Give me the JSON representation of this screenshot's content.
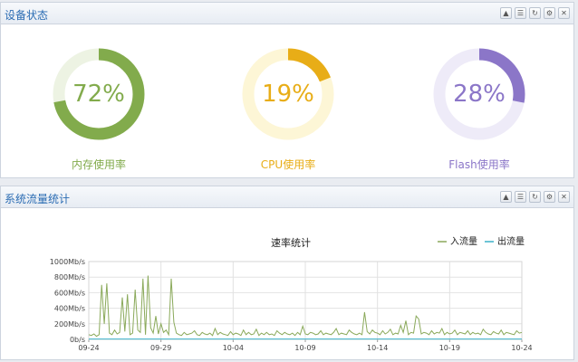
{
  "device_panel": {
    "title": "设备状态",
    "tools": [
      "▲",
      "☰",
      "↻",
      "⚙",
      "✕"
    ],
    "gauges": [
      {
        "value": 72,
        "display": "72%",
        "label": "内存使用率",
        "color": "#82ab4c",
        "track": "#edf3e3"
      },
      {
        "value": 19,
        "display": "19%",
        "label": "CPU使用率",
        "color": "#e8ad17",
        "track": "#fdf6d6"
      },
      {
        "value": 28,
        "display": "28%",
        "label": "Flash使用率",
        "color": "#8b76c8",
        "track": "#eeebf8"
      }
    ]
  },
  "traffic_panel": {
    "title": "系统流量统计",
    "tools": [
      "▲",
      "☰",
      "↻",
      "⚙",
      "✕"
    ]
  },
  "chart_data": {
    "type": "line",
    "title": "速率统计",
    "y_ticks": [
      "0b/s",
      "200Mb/s",
      "400Mb/s",
      "600Mb/s",
      "800Mb/s",
      "1000Mb/s"
    ],
    "ylim": [
      0,
      1000
    ],
    "x_ticks": [
      "09-24",
      "09-29",
      "10-04",
      "10-09",
      "10-14",
      "10-19",
      "10-24"
    ],
    "grid": true,
    "legend_position": "top-right",
    "series": [
      {
        "name": "入流量",
        "color": "#8aa95a",
        "values": [
          60,
          50,
          70,
          40,
          60,
          700,
          200,
          720,
          80,
          60,
          120,
          70,
          90,
          540,
          100,
          580,
          60,
          80,
          640,
          120,
          90,
          780,
          60,
          820,
          150,
          80,
          300,
          70,
          200,
          90,
          120,
          60,
          780,
          220,
          80,
          60,
          50,
          90,
          60,
          70,
          80,
          110,
          60,
          50,
          90,
          70,
          60,
          80,
          50,
          140,
          60,
          90,
          70,
          60,
          50,
          100,
          60,
          80,
          70,
          50,
          120,
          60,
          90,
          60,
          70,
          130,
          50,
          80,
          60,
          90,
          60,
          70,
          50,
          110,
          80,
          60,
          90,
          70,
          60,
          80,
          50,
          90,
          60,
          170,
          70,
          60,
          90,
          80,
          60,
          70,
          110,
          60,
          80,
          70,
          60,
          90,
          140,
          60,
          80,
          70,
          60,
          120,
          90,
          70,
          60,
          80,
          60,
          350,
          100,
          70,
          120,
          90,
          80,
          60,
          110,
          70,
          90,
          130,
          60,
          80,
          70,
          180,
          90,
          240,
          60,
          90,
          80,
          300,
          260,
          70,
          90,
          80,
          60,
          110,
          70,
          90,
          80,
          140,
          60,
          90,
          70,
          80,
          120,
          60,
          90,
          80,
          70,
          110,
          60,
          90,
          70,
          80,
          60,
          130,
          90,
          70,
          60,
          100,
          80,
          70,
          120,
          60,
          90,
          80,
          70,
          60,
          110,
          80,
          90
        ]
      },
      {
        "name": "出流量",
        "color": "#3ab0c8",
        "values": [
          5,
          5,
          5,
          5,
          5,
          5,
          5,
          5,
          5,
          5,
          5,
          5,
          5,
          5,
          5,
          5,
          5,
          5,
          5,
          5,
          5,
          5,
          5,
          5,
          5,
          5,
          5,
          5,
          5,
          5,
          5,
          5,
          5,
          5,
          5,
          5,
          5,
          5,
          5,
          5,
          5,
          5,
          5,
          5,
          5,
          5,
          5,
          5,
          5,
          5,
          5,
          5,
          5,
          5,
          5,
          5,
          5,
          5,
          5,
          5,
          5,
          5,
          5,
          5,
          5,
          5,
          5,
          5,
          5,
          5,
          5,
          5,
          5,
          5,
          5,
          5,
          5,
          5,
          5,
          5,
          5,
          5,
          5,
          5,
          5,
          5,
          5,
          5,
          5,
          5,
          5,
          5,
          5,
          5,
          5,
          5,
          5,
          5,
          5,
          5,
          5,
          5,
          5,
          5,
          5,
          5,
          5,
          5,
          5,
          5,
          5,
          5,
          5,
          5,
          5,
          5,
          5,
          5,
          5,
          5,
          5,
          5,
          5,
          5,
          5,
          5,
          5,
          5,
          5,
          5,
          5,
          5,
          5,
          5,
          5,
          5,
          5,
          5,
          5,
          5,
          5,
          5,
          5,
          5,
          5,
          5,
          5,
          5,
          5,
          5,
          5,
          5,
          5,
          5,
          5,
          5,
          5,
          5,
          5,
          5,
          5,
          5,
          5,
          5,
          5,
          5,
          5
        ]
      }
    ]
  }
}
